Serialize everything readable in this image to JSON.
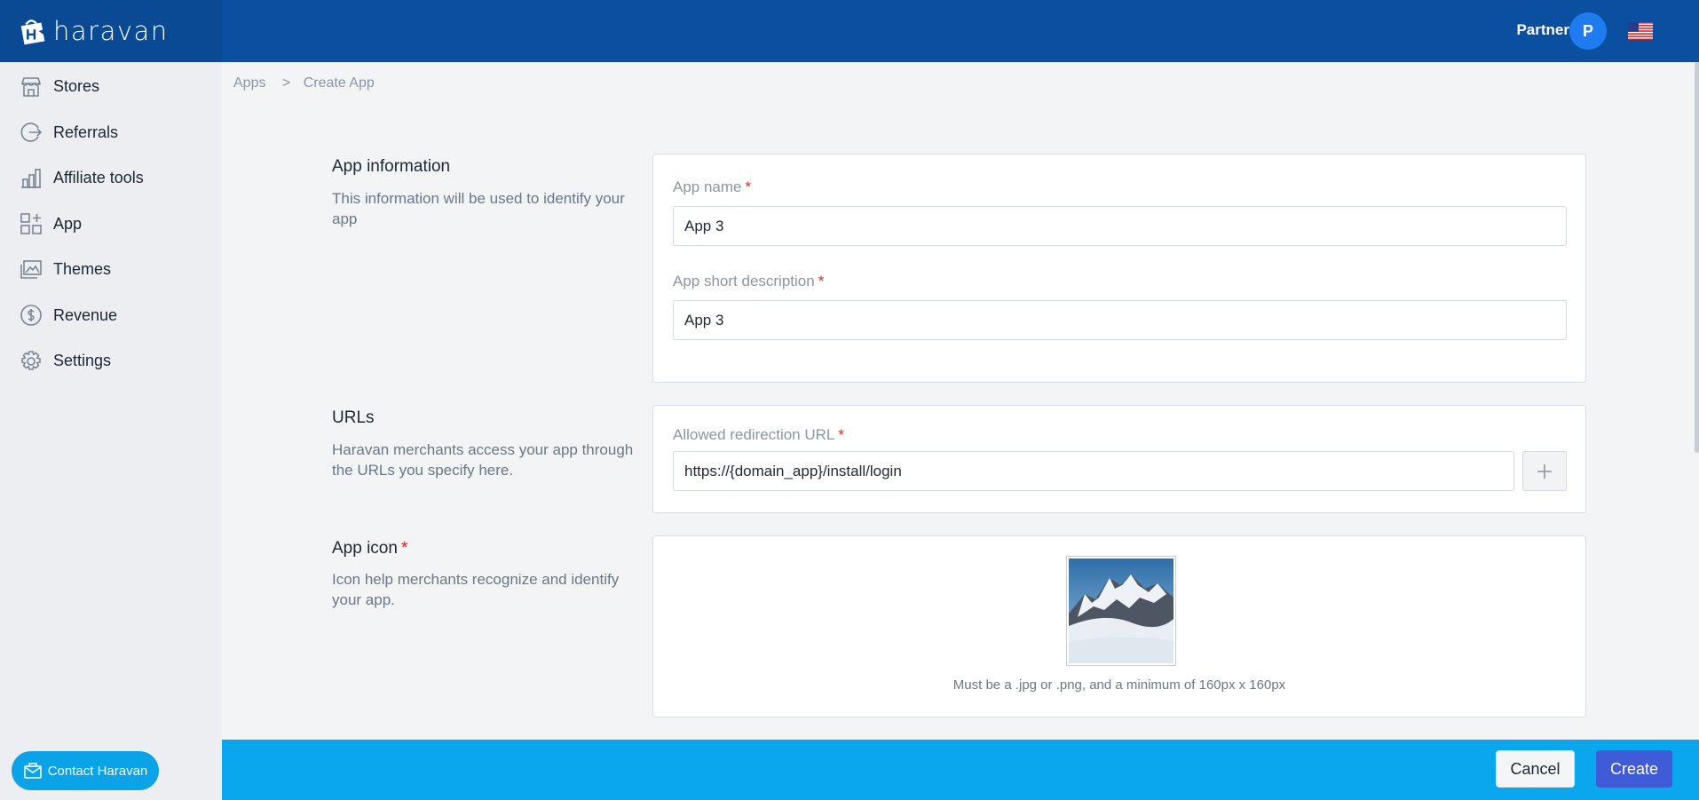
{
  "brand": {
    "name": "haravan"
  },
  "header": {
    "partner_label": "Partner",
    "avatar_initial": "P",
    "flag_icon": "us-flag-icon"
  },
  "sidebar": {
    "items": [
      {
        "label": "Stores",
        "icon": "store-icon"
      },
      {
        "label": "Referrals",
        "icon": "referral-icon"
      },
      {
        "label": "Affiliate tools",
        "icon": "bar-chart-icon"
      },
      {
        "label": "App",
        "icon": "app-grid-icon"
      },
      {
        "label": "Themes",
        "icon": "themes-icon"
      },
      {
        "label": "Revenue",
        "icon": "dollar-circle-icon"
      },
      {
        "label": "Settings",
        "icon": "gear-icon"
      }
    ],
    "contact_label": "Contact Haravan"
  },
  "breadcrumb": {
    "root": "Apps",
    "separator": ">",
    "current": "Create App"
  },
  "sections": {
    "app_info": {
      "title": "App information",
      "description": "This information will be used to identify your app",
      "app_name_label": "App name",
      "app_name_value": "App 3",
      "short_desc_label": "App short description",
      "short_desc_value": "App 3"
    },
    "urls": {
      "title": "URLs",
      "description": "Haravan merchants access your app through the URLs you specify here.",
      "redirect_label": "Allowed redirection URL",
      "redirect_value": "https://{domain_app}/install/login"
    },
    "icon": {
      "title": "App icon",
      "description": "Icon help merchants recognize and identify your app.",
      "hint": "Must be a .jpg or .png, and a minimum of 160px x 160px"
    },
    "required_marker": "*"
  },
  "footer": {
    "cancel_label": "Cancel",
    "create_label": "Create"
  },
  "colors": {
    "header": "#0b4fa0",
    "footer": "#0aa6ee",
    "primary_button": "#3f5bd8",
    "required": "#e02424"
  }
}
